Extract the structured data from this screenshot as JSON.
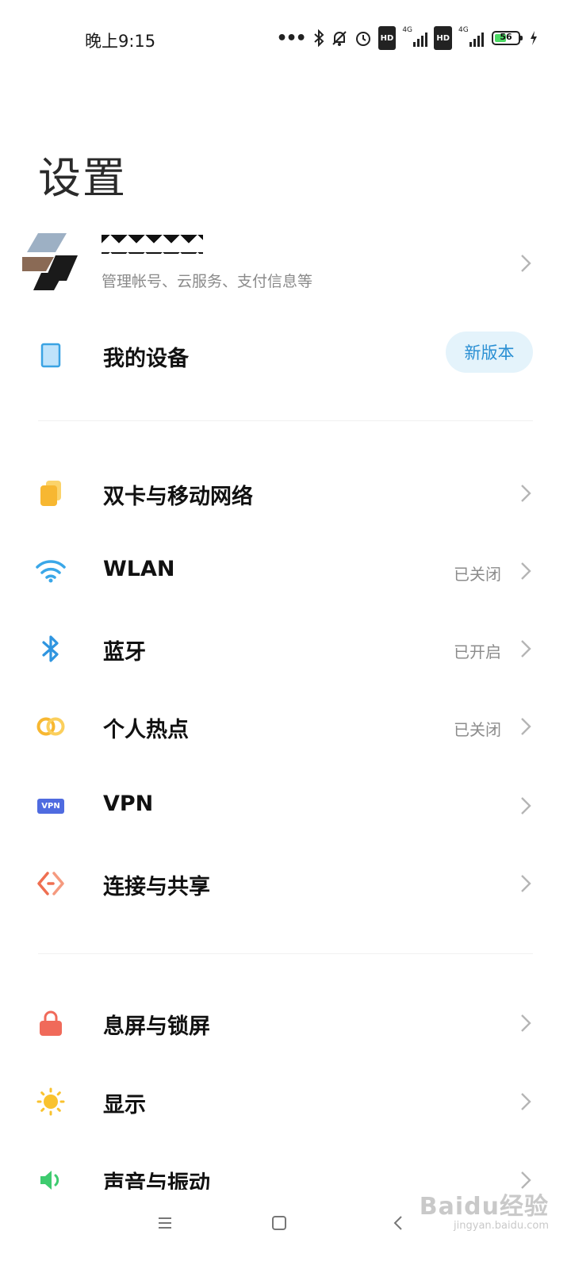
{
  "status_bar": {
    "time": "晚上9:15",
    "icons": [
      "more-dots-icon",
      "bluetooth-icon",
      "mute-bell-icon",
      "alarm-icon",
      "hd-icon",
      "signal-4g-icon",
      "hd-icon",
      "signal-4g-icon",
      "battery-icon",
      "charging-icon"
    ],
    "hd_label": "HD",
    "net_label": "4G",
    "battery_percent": "56",
    "battery_level": 0.56
  },
  "page": {
    "title": "设置"
  },
  "account": {
    "subtitle": "管理帐号、云服务、支付信息等"
  },
  "my_device": {
    "label": "我的设备",
    "badge": "新版本",
    "icon": "device-icon"
  },
  "network_items": [
    {
      "label": "双卡与移动网络",
      "value": "",
      "icon": "sim-card-icon",
      "color": "#f7b731"
    },
    {
      "label": "WLAN",
      "value": "已关闭",
      "icon": "wifi-icon",
      "color": "#3aa7e8"
    },
    {
      "label": "蓝牙",
      "value": "已开启",
      "icon": "bluetooth-icon",
      "color": "#2f95e0"
    },
    {
      "label": "个人热点",
      "value": "已关闭",
      "icon": "hotspot-icon",
      "color": "#f7b731"
    },
    {
      "label": "VPN",
      "value": "",
      "icon": "vpn-icon",
      "color": "#4f6be0"
    },
    {
      "label": "连接与共享",
      "value": "",
      "icon": "connection-share-icon",
      "color": "#ef6f51"
    }
  ],
  "vpn_icon_text": "VPN",
  "display_items": [
    {
      "label": "息屏与锁屏",
      "icon": "lock-icon",
      "color": "#f06a5a"
    },
    {
      "label": "显示",
      "icon": "sun-icon",
      "color": "#f9c22e"
    },
    {
      "label": "声音与振动",
      "icon": "speaker-icon",
      "color": "#3ecb6f"
    }
  ],
  "nav": [
    "menu-icon",
    "home-icon",
    "back-icon"
  ],
  "watermark": {
    "logo": "Baidu经验",
    "url": "jingyan.baidu.com"
  }
}
